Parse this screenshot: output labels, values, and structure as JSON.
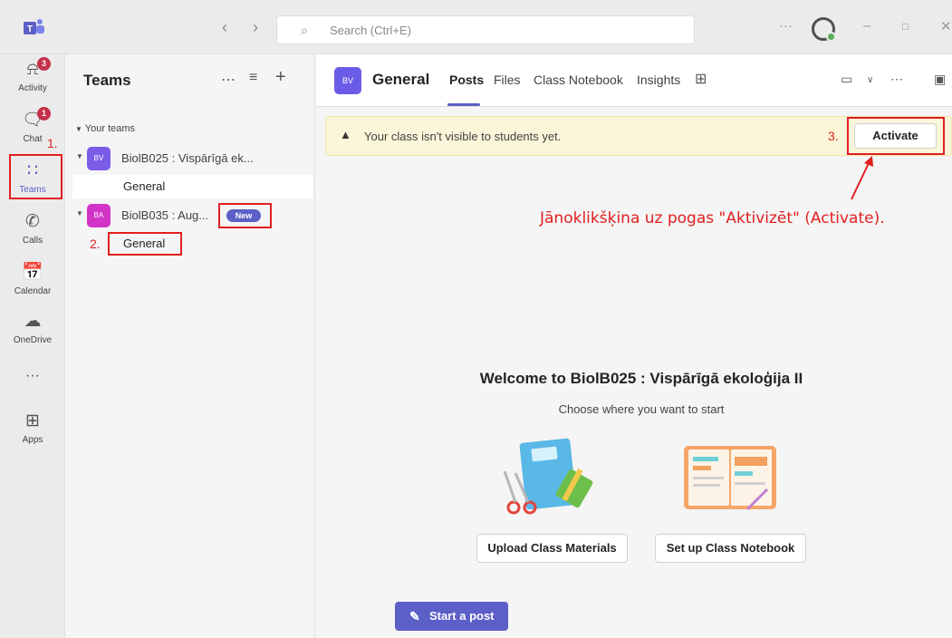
{
  "titlebar": {
    "search_placeholder": "Search (Ctrl+E)",
    "more": "···"
  },
  "rail": {
    "items": [
      {
        "label": "Activity",
        "badge": "3"
      },
      {
        "label": "Chat",
        "badge": "1"
      },
      {
        "label": "Teams"
      },
      {
        "label": "Calls"
      },
      {
        "label": "Calendar"
      },
      {
        "label": "OneDrive"
      },
      {
        "label": "···"
      },
      {
        "label": "Apps"
      }
    ]
  },
  "panel": {
    "title": "Teams",
    "section_label": "Your teams",
    "teams": [
      {
        "initials": "BV",
        "name": "BiolB025 : Vispārīgā ek...",
        "color": "#7b5ce7",
        "channel": "General"
      },
      {
        "initials": "BA",
        "name": "BiolB035 : Aug...",
        "color": "#d234c8",
        "badge": "New",
        "channel": "General"
      }
    ]
  },
  "header": {
    "initials": "BV",
    "title": "General",
    "tabs": [
      "Posts",
      "Files",
      "Class Notebook",
      "Insights"
    ]
  },
  "banner": {
    "message": "Your class isn't visible to students yet.",
    "button": "Activate"
  },
  "welcome": {
    "title": "Welcome to BiolB025 : Vispārīgā ekoloģija II",
    "subtitle": "Choose where you want to start",
    "upload_button": "Upload Class Materials",
    "notebook_button": "Set up Class Notebook",
    "post_button": "Start a post"
  },
  "annotations": {
    "n1": "1.",
    "n2": "2.",
    "n3": "3.",
    "text": "Jānoklikšķina uz pogas \"Aktivizēt\" (Activate)."
  },
  "colors": {
    "accent": "#5b5fc7",
    "annotation": "#e02020",
    "badge": "#c4314b"
  }
}
